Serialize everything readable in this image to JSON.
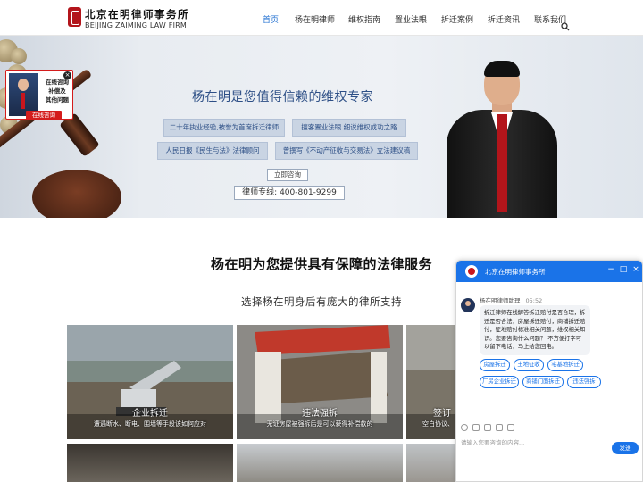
{
  "header": {
    "logo_cn": "北京在明律师事务所",
    "logo_en": "BEIJING ZAIMING LAW FIRM",
    "nav": [
      "首页",
      "杨在明律师",
      "维权指南",
      "置业法眼",
      "拆迁案例",
      "拆迁资讯",
      "联系我们"
    ],
    "active_index": 0,
    "search_icon": "search-icon"
  },
  "hero": {
    "title": "杨在明是您值得信赖的维权专家",
    "tags": [
      "二十年执业经验,被誉为首席拆迁律师",
      "擅客置业法眼 细说维权成功之路",
      "人民日报《民生与法》法律顾问",
      "曾撰写《不动产征收与交易法》立法建议稿"
    ],
    "consult_button": "立即咨询",
    "hotline": "律师专线: 400-801-9299"
  },
  "promo": {
    "text_lines": [
      "在线咨询",
      "补偿及",
      "其他问题"
    ],
    "button": "在线咨询",
    "close": "×"
  },
  "services": {
    "title": "杨在明为您提供具有保障的法律服务",
    "subtitle": "选择杨在明身后有庞大的律所支持",
    "cards": [
      {
        "title": "企业拆迁",
        "desc": "遭遇断水、断电、围墙等手段该如何应对"
      },
      {
        "title": "违法强拆",
        "desc": "无证房屋被强拆后是可以获得补偿款的"
      },
      {
        "title": "签订",
        "desc": "空白协议、"
      }
    ]
  },
  "chat": {
    "title": "北京在明律师事务所",
    "controls": [
      "−",
      "□",
      "×"
    ],
    "agent_name": "杨在明律师助理",
    "time": "05:52",
    "message": "拆迁律师在线解答拆迁赔付是否合理，拆迁是否合法，房屋拆迁赔付，商铺拆迁赔付，征地赔付标准相关问题，维权相关知识。您要咨询什么问题？ 不方便打字可以留下电话，马上给您回电。",
    "quick_replies": [
      "房屋拆迁",
      "土地征收",
      "宅基地拆迁",
      "厂房企业拆迁",
      "商铺门面拆迁",
      "违法强拆"
    ],
    "input_placeholder": "请输入您要咨询的内容...",
    "send": "发送"
  }
}
